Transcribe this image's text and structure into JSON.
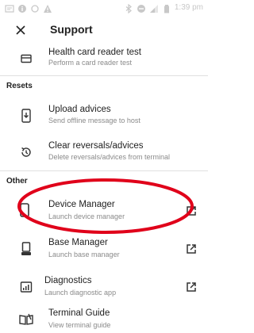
{
  "status_bar": {
    "time": "1:39 pm"
  },
  "app_bar": {
    "title": "Support"
  },
  "items": [
    {
      "title": "Health card reader test",
      "subtitle": "Perform a card reader test",
      "icon": "card-reader-icon"
    },
    {
      "title": "Upload advices",
      "subtitle": "Send offline message to host",
      "icon": "upload-icon"
    },
    {
      "title": "Clear reversals/advices",
      "subtitle": "Delete reversals/advices from terminal",
      "icon": "history-icon"
    },
    {
      "title": "Device Manager",
      "subtitle": "Launch device manager",
      "icon": "phone-icon",
      "external": true
    },
    {
      "title": "Base Manager",
      "subtitle": "Launch base manager",
      "icon": "base-icon",
      "external": true
    },
    {
      "title": "Diagnostics",
      "subtitle": "Launch diagnostic app",
      "icon": "diagnostics-icon",
      "external": true
    },
    {
      "title": "Terminal Guide",
      "subtitle": "View terminal guide",
      "icon": "book-icon"
    }
  ],
  "sections": {
    "resets": "Resets",
    "other": "Other"
  },
  "colors": {
    "highlight": "#e0001a",
    "icon": "#333333",
    "subtitle": "#8a8a8a"
  }
}
